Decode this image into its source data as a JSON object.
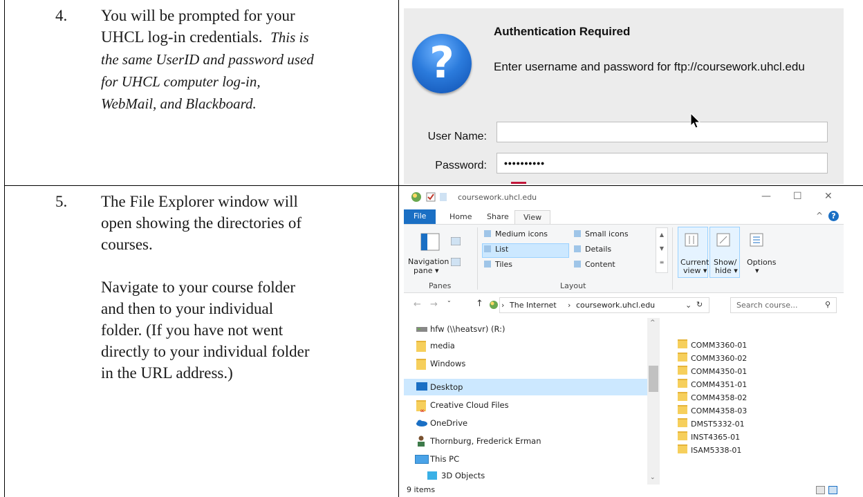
{
  "left": {
    "step4": {
      "num": "4.",
      "line1": "You will be prompted for your",
      "line2": "UHCL log-in credentials.",
      "italic_a": "This is",
      "italic_b": "the same UserID and password used",
      "italic_c": "for UHCL computer log-in,",
      "italic_d": "WebMail, and Blackboard."
    },
    "step5": {
      "num": "5.",
      "l1": "The File Explorer window will",
      "l2": "open showing the directories of",
      "l3": "courses.",
      "p2l1": "Navigate to your course folder",
      "p2l2": "and then to your individual",
      "p2l3": "folder. (If you have not went",
      "p2l4": "directly to your individual folder",
      "p2l5": "in the URL address.)"
    }
  },
  "auth": {
    "icon": "question-icon",
    "icon_glyph": "?",
    "title": "Authentication Required",
    "message": "Enter username and password for ftp://coursework.uhcl.edu",
    "username_label": "User Name:",
    "username_value": "",
    "password_label": "Password:",
    "password_value": "••••••••••"
  },
  "explorer": {
    "title": "coursework.uhcl.edu",
    "controls": {
      "minimize": "—",
      "maximize": "☐",
      "close": "✕"
    },
    "tabs": [
      "File",
      "Home",
      "Share",
      "View"
    ],
    "help": "?",
    "ribbon": {
      "navigation_pane": "Navigation",
      "navigation_pane2": "pane ▾",
      "panes_group": "Panes",
      "layout_group": "Layout",
      "medium_icons": "Medium icons",
      "small_icons": "Small icons",
      "list": "List",
      "details": "Details",
      "tiles": "Tiles",
      "content": "Content",
      "current_view": "Current",
      "current_view2": "view ▾",
      "show_hide": "Show/",
      "show_hide2": "hide ▾",
      "options": "Options",
      "options2": "▾"
    },
    "breadcrumb": [
      "The Internet",
      "coursework.uhcl.edu"
    ],
    "search_placeholder": "Search course...",
    "nav_items": [
      "hfw (\\\\heatsvr) (R:)",
      "media",
      "Windows",
      "Desktop",
      "Creative Cloud Files",
      "OneDrive",
      "Thornburg, Frederick Erman",
      "This PC",
      "3D Objects"
    ],
    "files": [
      "COMM3360-01",
      "COMM3360-02",
      "COMM4350-01",
      "COMM4351-01",
      "COMM4358-02",
      "COMM4358-03",
      "DMST5332-01",
      "INST4365-01",
      "ISAM5338-01"
    ],
    "status": "9 items",
    "colors": {
      "file_tab": "#1a6fc4",
      "selection": "#cce8ff",
      "folder": "#f6cf5c"
    }
  }
}
